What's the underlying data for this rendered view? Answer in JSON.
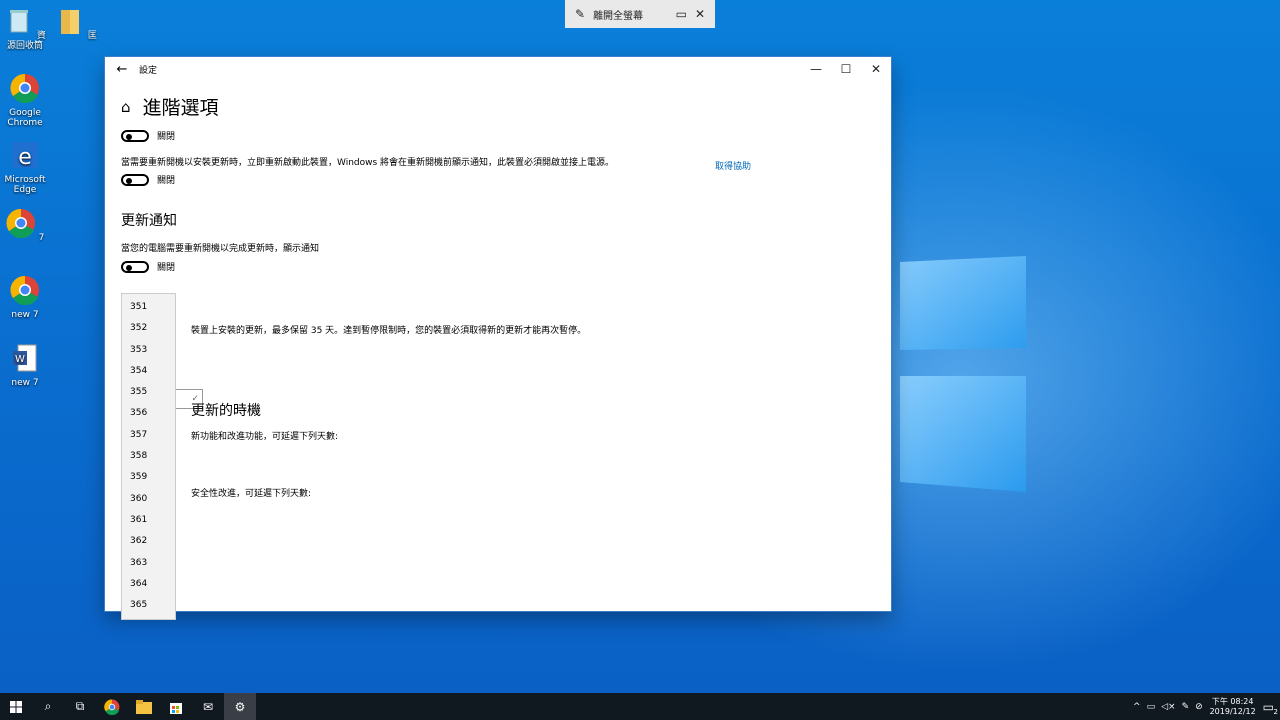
{
  "fullscreen_bar": {
    "exit_label": "離開全螢幕"
  },
  "desktop_icons": [
    {
      "label": "資源回收筒",
      "icon": "recycle-bin-icon"
    },
    {
      "label": "匡",
      "icon": "folder-icon"
    },
    {
      "label": "Google Chrome",
      "icon": "chrome-icon"
    },
    {
      "label": "Microsoft Edge",
      "icon": "edge-icon"
    },
    {
      "label": "7",
      "icon": "chrome-icon"
    },
    {
      "label": "new 7",
      "icon": "chrome-icon"
    },
    {
      "label": "new 7",
      "icon": "word-doc-icon"
    }
  ],
  "window": {
    "title": "設定",
    "page_title": "進階選項",
    "help_link": "取得協助",
    "toggle1_state": "關閉",
    "restart_notice_text": "當需要重新開機以安裝更新時，立即重新啟動此裝置，Windows 將會在重新開機前顯示通知，此裝置必須開啟並接上電源。",
    "toggle2_state": "關閉",
    "update_notify_heading": "更新通知",
    "update_notify_text": "當您的電腦需要重新開機以完成更新時，顯示通知",
    "toggle3_state": "關閉",
    "pause_text": "裝置上安裝的更新，最多保留 35 天。達到暫停限制時，您的裝置必須取得新的更新才能再次暫停。",
    "choose_time_heading": "更新的時機",
    "feature_defer_text": "新功能和改進功能，可延遲下列天數:",
    "quality_defer_text": "安全性改進，可延遲下列天數:"
  },
  "dropdown_options": [
    "351",
    "352",
    "353",
    "354",
    "355",
    "356",
    "357",
    "358",
    "359",
    "360",
    "361",
    "362",
    "363",
    "364",
    "365"
  ],
  "taskbar": {
    "clock_line1": "下午 08:24",
    "clock_line2": "2019/12/12",
    "notification_count": "2"
  }
}
